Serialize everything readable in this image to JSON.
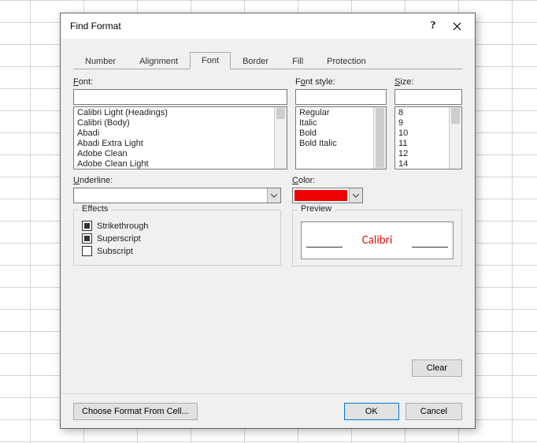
{
  "dialog": {
    "title": "Find Format",
    "help": "?",
    "tabs": [
      "Number",
      "Alignment",
      "Font",
      "Border",
      "Fill",
      "Protection"
    ],
    "active_tab_index": 2
  },
  "font_section": {
    "label": "Font:",
    "items": [
      "Calibri Light (Headings)",
      "Calibri (Body)",
      "Abadi",
      "Abadi Extra Light",
      "Adobe Clean",
      "Adobe Clean Light"
    ]
  },
  "style_section": {
    "label": "Font style:",
    "items": [
      "Regular",
      "Italic",
      "Bold",
      "Bold Italic"
    ]
  },
  "size_section": {
    "label": "Size:",
    "items": [
      "8",
      "9",
      "10",
      "11",
      "12",
      "14"
    ]
  },
  "underline": {
    "label_pre": "",
    "label_u": "U",
    "label_post": "nderline:"
  },
  "color": {
    "label_pre": "",
    "label_u": "C",
    "label_post": "olor:",
    "value": "#f00000"
  },
  "effects": {
    "legend": "Effects",
    "strikethrough": {
      "label_pre": "Stri",
      "label_u": "k",
      "label_post": "ethrough",
      "checked": true
    },
    "superscript": {
      "label_pre": "Sup",
      "label_u": "e",
      "label_post": "rscript",
      "checked": true
    },
    "subscript": {
      "label_pre": "Su",
      "label_u": "b",
      "label_post": "script",
      "checked": false
    }
  },
  "preview": {
    "legend": "Preview",
    "text": "Calibri",
    "text_color": "#e01010"
  },
  "buttons": {
    "clear": "Clear",
    "choose": "Choose Format From Cell...",
    "ok": "OK",
    "cancel": "Cancel"
  }
}
